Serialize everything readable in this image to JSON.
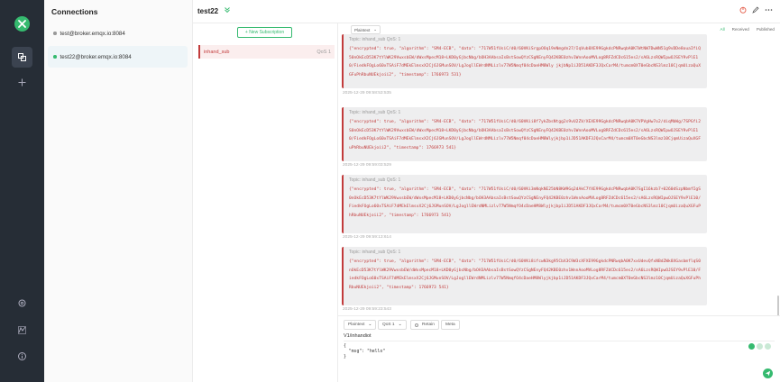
{
  "sidebar": {
    "icons": [
      "logo-icon",
      "connections-icon",
      "new-connection-icon",
      "settings-icon",
      "script-icon",
      "about-icon"
    ]
  },
  "connections_panel": {
    "title": "Connections",
    "items": [
      {
        "label": "test@broker.emqx.io:8084",
        "status": "offline"
      },
      {
        "label": "test22@broker.emqx.io:8084",
        "status": "online"
      }
    ]
  },
  "header": {
    "connection_name": "test22"
  },
  "subscriptions": {
    "new_button_label": "+ New Subscription",
    "items": [
      {
        "topic": "inhand_sub",
        "qos": "QoS 1",
        "color": "#c23b3b"
      }
    ]
  },
  "messages": {
    "format_select": "Plaintext",
    "filters": [
      "All",
      "Received",
      "Published"
    ],
    "active_filter": "All",
    "partial_top": {
      "topic": "Topic: inhand_sub   QoS: 1",
      "payload": "{\"encrypted\": true, \"algorithm\": \"SM4-ECB\", \"data\": \"717W51fUsiC/d0/60VKiSrgpOOq19eNmgdn27/IqVub8XE99GgkdcPNRwqbA0K7WtNW7DwWN51g9vDDe8ouaIfiQ50nOkEcD53K7tYlWK29VwxsbEW/dWxsMpecM18+LKD0yGjbcNbg/bOH3AAbsaIsBstSowQYzCSgNEnyFQ42KBE0zhv1WnnAooMVLog8RFZdCDc615es2/sA6LzsRQWIpwOJSEY9vPlE10/FiedkFOgLo60xTSAiF7dMEkElmsxX2Cj6JGMunSOV/LgJogllEWrdNMLizlv77W5Nmqf04cDaeHM8Wly jkjbNp1iJD51AKDF3JQxCarM4/tumcm0XT0eGbcNS3lmz10CjqmUizaQuXGFuPhRbuNUEkjoii2\", \"timestamp\": 1766973 531}",
      "timestamp": "2025-12-29 09:58:53:535"
    },
    "items": [
      {
        "topic": "Topic: inhand_sub   QoS: 1",
        "payload": "{\"encrypted\": true, \"algorithm\": \"SM4-ECB\", \"data\": \"717W51fUsiC/d0/60VKii8f7ykZbsNtgg2s9vU2ZV/XEXE99GgkdcPNRwqbA0K7VPVgHw7o2/diqMbWg/7SPGfi2S0nOkEcD53K7tYlWK29VwxsbEW/dWxsMpecM18+LKD0yGjbcNbg/bOH3AAbsaIsBstSowQYzCSgNEnyFQ42KBE0zhv1WnnAooMVLog8RFZdCDc615es2/sA6LzsRQWIpwOJSEY9vPlE10/FiedkFOgLo60xTSAiF7dMEkElmsxX2Cj6JGMunSOV/LgJogllEWrdNMLizlv77W5Nmqf04cDaeHM8Wlyjkjbp1iJD51AKDF3JQxCarM4/tumcm0XT0eGbcNS3lmz10CjqmUizaQuXGFuPhRbuNUEkjoii2\", \"timestamp\": 1766973 541}",
        "timestamp": "2025-12-29 09:59:03:529"
      },
      {
        "topic": "Topic: inhand_sub   QoS: 1",
        "payload": "{\"encrypted\": true, \"algorithm\": \"SM4-ECB\", \"data\": \"717W51fUsiC/d0/60VKi3mNqkNE25bN8KW9Gq2dAkC7YXE99GgkdcPNRwqbA0K7SgI16kzb7+0260dSzpNbmfIgS0nOkEcD53K7tYlWK29VwxsbEW/dWxsMpecM18+LKD0yGjbcNbg/bOH3AAbsaIsBstSowQYzCSgNEnyFQ42KBE0zhv1WnnAooMVLog8RFZdCDc615es2/sA6LzsRQWIpwOJSEY9vPlE10/FiedkFOgLo60xTSAiF7dMEkElmsxX2Cj6JGMunSOV/LgJogllEWrdNMLizlv77W5NmqfO4cDaeHM8Wlyjkjbp1iJD51AKDF3JQxCarM4/tumcm0XT0eGbcNS3lmz10CjqmUizaQuXGFuPhRbuNUEkjoii2\", \"timestamp\": 1766973 541}",
        "timestamp": "2025-12-29 09:59:13:614"
      },
      {
        "topic": "Topic: inhand_sub   QoS: 1",
        "payload": "{\"encrypted\": true, \"algorithm\": \"SM4-ECB\", \"data\": \"717W51fUsiC/d0/60VKi8ifcwN3kg95CbX3C9W3cXFXE99GgkdcPNRwqbA0K7xxUdevQfxNBdZWk8XGasbmflqS0nOkEcD53K7tYlWK29VwxsbEW/dWxsMpecM18+LKD0yGjbcNbg/bOH3AAbsaIsBstSowQYzCSgNEnyFQ42KBE0zhv1WnnAooMVLog8RFZdCDc615es2/sA6LzsRQWIpwOJSEY9vPlE10/FiedkFOgLo60xTSAiF7dMEkElmsxX2Cj6JGMunSOV/LgJogllEWrdNMLizlv77W5NmqfO4cDaeHM8Wlyjkjbp1iJD51AKDF3JQxCarM4/tumcm0XT0eGbcNS3lmz10CjqmUizaQuXGFuPhRbuNUEkjoii2\", \"timestamp\": 1766973 541}",
        "timestamp": "2025-12-29 09:59:23:543"
      }
    ]
  },
  "composer": {
    "format": "Plaintext",
    "qos": "QoS 1",
    "retain_label": "Retain",
    "meta_label": "Meta",
    "topic_value": "V1/inhandiot",
    "payload": "{\n  \"msg\": \"hello\"\n}"
  }
}
